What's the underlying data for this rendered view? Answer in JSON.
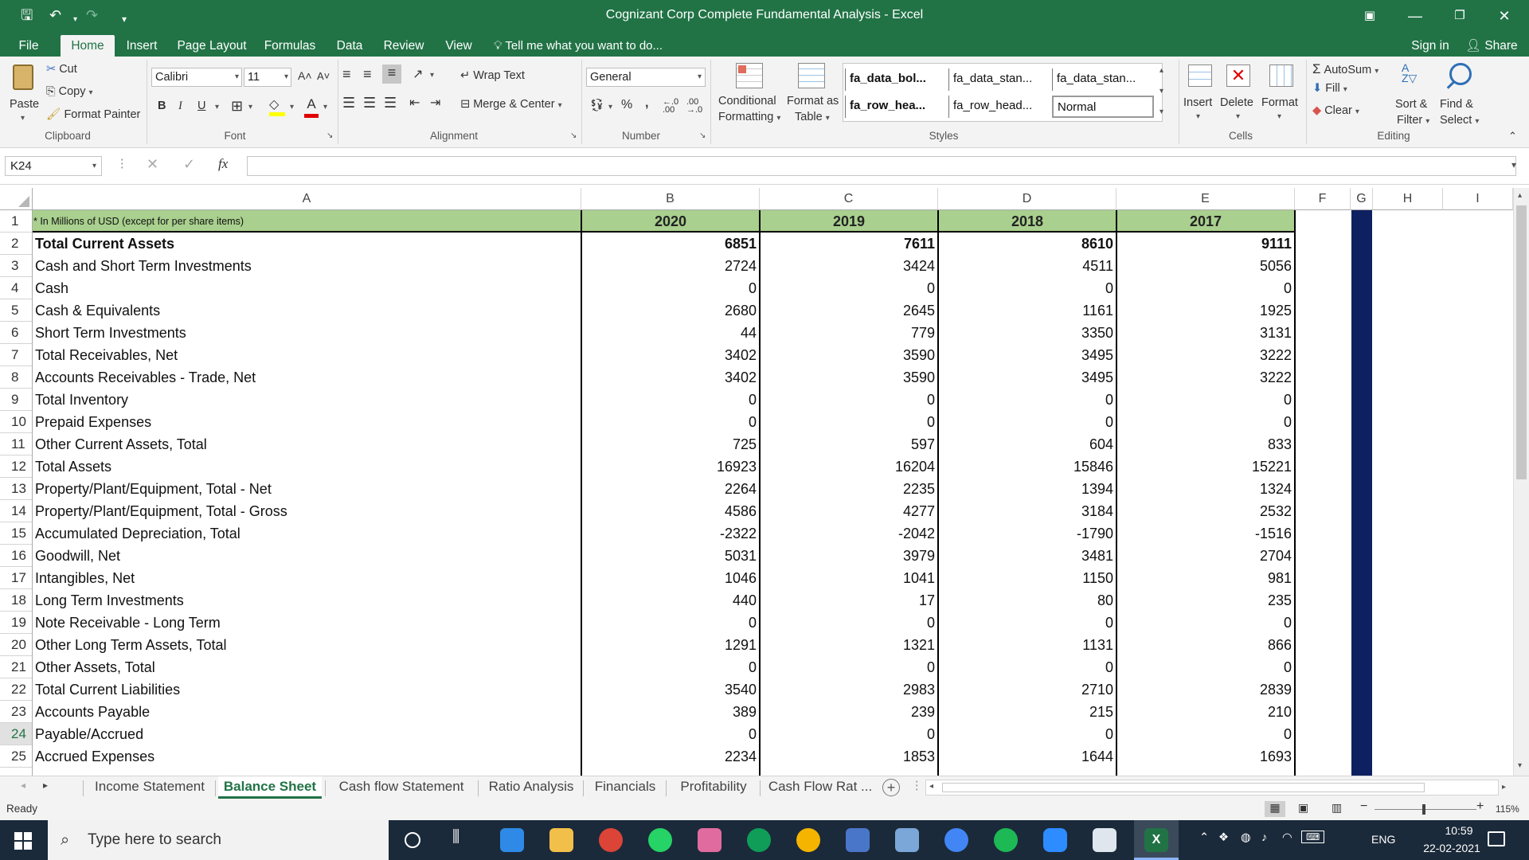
{
  "window": {
    "title": "Cognizant Corp Complete Fundamental Analysis - Excel"
  },
  "ribbon_tabs": [
    "File",
    "Home",
    "Insert",
    "Page Layout",
    "Formulas",
    "Data",
    "Review",
    "View"
  ],
  "tell_me": "Tell me what you want to do...",
  "signin": "Sign in",
  "share": "Share",
  "clipboard": {
    "paste": "Paste",
    "cut": "Cut",
    "copy": "Copy",
    "format_painter": "Format Painter",
    "label": "Clipboard"
  },
  "font": {
    "name": "Calibri",
    "size": "11",
    "label": "Font"
  },
  "alignment": {
    "wrap": "Wrap Text",
    "merge": "Merge & Center",
    "label": "Alignment"
  },
  "number": {
    "format": "General",
    "label": "Number",
    "percent": "%",
    "comma": ","
  },
  "styles": {
    "conditional": "Conditional",
    "formatting": "Formatting",
    "format_as": "Format as",
    "table": "Table",
    "cells": [
      "fa_data_bol...",
      "fa_data_stan...",
      "fa_data_stan...",
      "fa_row_hea...",
      "fa_row_head...",
      "Normal"
    ],
    "label": "Styles"
  },
  "cells_group": {
    "insert": "Insert",
    "delete": "Delete",
    "format": "Format",
    "label": "Cells"
  },
  "editing": {
    "autosum": "AutoSum",
    "fill": "Fill",
    "clear": "Clear",
    "sort": "Sort &",
    "filter": "Filter",
    "find": "Find &",
    "select": "Select",
    "label": "Editing"
  },
  "formula_bar": {
    "name_box": "K24",
    "fx": "fx",
    "content": ""
  },
  "columns": [
    "A",
    "B",
    "C",
    "D",
    "E",
    "F",
    "G",
    "H",
    "I"
  ],
  "header_row": {
    "note": "* In Millions of USD (except for per share items)",
    "years": [
      "2020",
      "2019",
      "2018",
      "2017"
    ]
  },
  "rows": [
    {
      "n": "2",
      "label": "Total Current Assets",
      "bold": true,
      "values": [
        "6851",
        "7611",
        "8610",
        "9111"
      ]
    },
    {
      "n": "3",
      "label": "Cash and Short Term Investments",
      "values": [
        "2724",
        "3424",
        "4511",
        "5056"
      ]
    },
    {
      "n": "4",
      "label": "Cash",
      "values": [
        "0",
        "0",
        "0",
        "0"
      ]
    },
    {
      "n": "5",
      "label": "Cash & Equivalents",
      "values": [
        "2680",
        "2645",
        "1161",
        "1925"
      ]
    },
    {
      "n": "6",
      "label": "Short Term Investments",
      "values": [
        "44",
        "779",
        "3350",
        "3131"
      ]
    },
    {
      "n": "7",
      "label": "Total Receivables, Net",
      "values": [
        "3402",
        "3590",
        "3495",
        "3222"
      ]
    },
    {
      "n": "8",
      "label": "Accounts Receivables - Trade, Net",
      "values": [
        "3402",
        "3590",
        "3495",
        "3222"
      ]
    },
    {
      "n": "9",
      "label": "Total Inventory",
      "values": [
        "0",
        "0",
        "0",
        "0"
      ]
    },
    {
      "n": "10",
      "label": "Prepaid Expenses",
      "values": [
        "0",
        "0",
        "0",
        "0"
      ]
    },
    {
      "n": "11",
      "label": "Other Current Assets, Total",
      "values": [
        "725",
        "597",
        "604",
        "833"
      ]
    },
    {
      "n": "12",
      "label": "Total Assets",
      "values": [
        "16923",
        "16204",
        "15846",
        "15221"
      ]
    },
    {
      "n": "13",
      "label": "Property/Plant/Equipment, Total - Net",
      "values": [
        "2264",
        "2235",
        "1394",
        "1324"
      ]
    },
    {
      "n": "14",
      "label": "Property/Plant/Equipment, Total - Gross",
      "values": [
        "4586",
        "4277",
        "3184",
        "2532"
      ]
    },
    {
      "n": "15",
      "label": "Accumulated Depreciation, Total",
      "values": [
        "-2322",
        "-2042",
        "-1790",
        "-1516"
      ]
    },
    {
      "n": "16",
      "label": "Goodwill, Net",
      "values": [
        "5031",
        "3979",
        "3481",
        "2704"
      ]
    },
    {
      "n": "17",
      "label": "Intangibles, Net",
      "values": [
        "1046",
        "1041",
        "1150",
        "981"
      ]
    },
    {
      "n": "18",
      "label": "Long Term Investments",
      "values": [
        "440",
        "17",
        "80",
        "235"
      ]
    },
    {
      "n": "19",
      "label": "Note Receivable - Long Term",
      "values": [
        "0",
        "0",
        "0",
        "0"
      ]
    },
    {
      "n": "20",
      "label": "Other Long Term Assets, Total",
      "values": [
        "1291",
        "1321",
        "1131",
        "866"
      ]
    },
    {
      "n": "21",
      "label": "Other Assets, Total",
      "values": [
        "0",
        "0",
        "0",
        "0"
      ]
    },
    {
      "n": "22",
      "label": "Total Current Liabilities",
      "values": [
        "3540",
        "2983",
        "2710",
        "2839"
      ]
    },
    {
      "n": "23",
      "label": "Accounts Payable",
      "values": [
        "389",
        "239",
        "215",
        "210"
      ]
    },
    {
      "n": "24",
      "label": "Payable/Accrued",
      "values": [
        "0",
        "0",
        "0",
        "0"
      ]
    },
    {
      "n": "25",
      "label": "Accrued Expenses",
      "values": [
        "2234",
        "1853",
        "1644",
        "1693"
      ]
    }
  ],
  "sheet_tabs": [
    "Income Statement",
    "Balance Sheet",
    "Cash flow Statement",
    "Ratio Analysis",
    "Financials",
    "Profitability",
    "Cash Flow Rat ..."
  ],
  "active_sheet": "Balance Sheet",
  "status": {
    "ready": "Ready",
    "zoom": "115%"
  },
  "taskbar": {
    "search_placeholder": "Type here to search",
    "lang": "ENG",
    "time": "10:59",
    "date": "22-02-2021"
  },
  "colors": {
    "excel_green": "#217346",
    "header_fill": "#a9d08e",
    "col_g_fill": "#0d2160",
    "taskbar": "#1b2a3a"
  }
}
